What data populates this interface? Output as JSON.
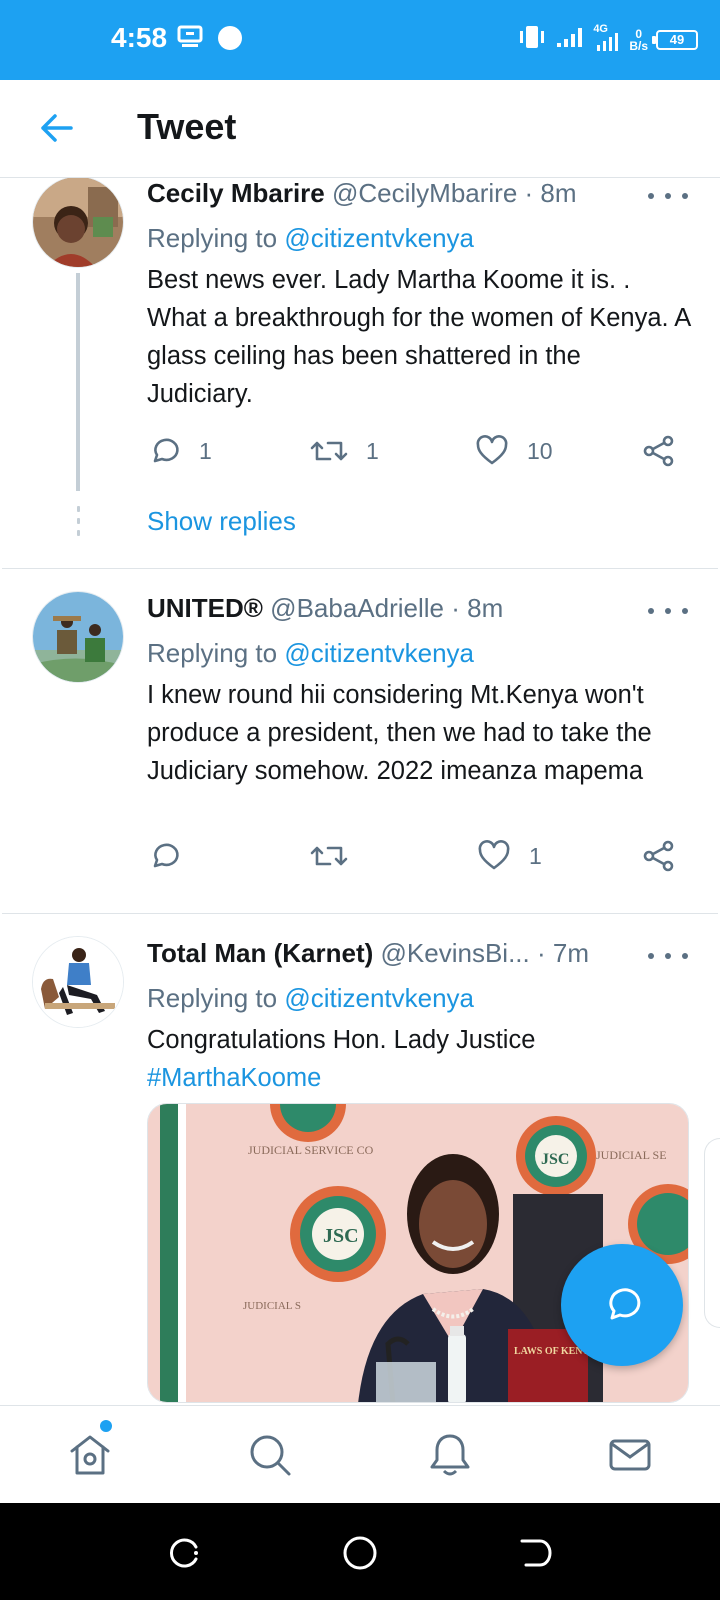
{
  "status_bar": {
    "time": "4:58",
    "network": "4G",
    "net_speed_value": "0",
    "net_speed_unit": "B/s",
    "battery": "49",
    "background": "#1da1f2"
  },
  "header": {
    "title": "Tweet",
    "back_icon": "arrow-left-icon"
  },
  "tweets": [
    {
      "name": "Cecily Mbarire",
      "handle": "@CecilyMbarire",
      "time": "· 8m",
      "replying_prefix": "Replying to",
      "replying_to": "@citizentvkenya",
      "text": "Best news ever. Lady Martha Koome it is. . What a breakthrough for the women of Kenya. A glass ceiling has been shattered in the Judiciary.",
      "replies": "1",
      "retweets": "1",
      "likes": "10",
      "show_replies": "Show replies"
    },
    {
      "name": "UNITED®",
      "handle": "@BabaAdrielle",
      "time": "· 8m",
      "replying_prefix": "Replying to",
      "replying_to": "@citizentvkenya",
      "text": "I knew round hii considering Mt.Kenya won't produce a president, then we had to take the Judiciary somehow. 2022 imeanza mapema",
      "replies": "",
      "retweets": "",
      "likes": "1"
    },
    {
      "name": "Total Man (Karnet)",
      "handle": "@KevinsBi...",
      "time": "· 7m",
      "replying_prefix": "Replying to",
      "replying_to": "@citizentvkenya",
      "text": "Congratulations Hon. Lady Justice",
      "hashtag": "#MarthaKoome",
      "media": {
        "banner_left": "JUDICIAL SERVICE CO",
        "banner_right": "JUDICIAL SE",
        "banner_bottom": "JUDICIAL S",
        "emblem": "JSC",
        "book_label": "LAWS OF KENYA"
      }
    }
  ],
  "bottom_nav": {
    "items": [
      "home-icon",
      "search-icon",
      "notifications-icon",
      "messages-icon"
    ],
    "accent": "#1da1f2"
  },
  "fab": {
    "icon": "compose-reply-icon"
  },
  "colors": {
    "accent": "#1da1f2",
    "link": "#1b95e0",
    "secondary_text": "#5b7083"
  }
}
